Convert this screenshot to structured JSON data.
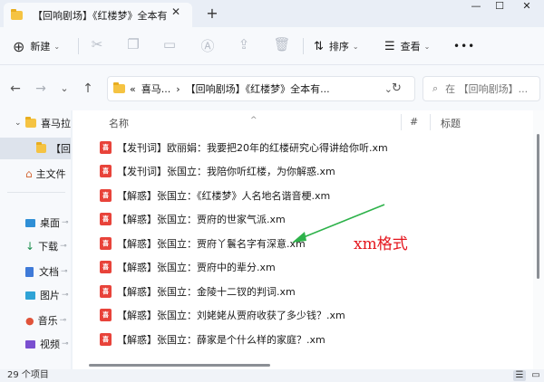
{
  "window": {
    "tab_title": "【回响剧场】《红楼梦》全本有",
    "tab_close": "✕",
    "new_tab": "+",
    "minimize": "—",
    "maximize": "☐",
    "close": "✕"
  },
  "toolbar": {
    "new_label": "新建",
    "sort_label": "排序",
    "view_label": "查看",
    "more_label": "•••"
  },
  "nav": {
    "back": "←",
    "forward": "→",
    "dropdown": "⌄",
    "up": "↑",
    "refresh": "↻"
  },
  "address": {
    "prefix": "«",
    "crumb1": "喜马...",
    "sep": "›",
    "crumb2": "【回响剧场】《红楼梦》全本有...",
    "dropdown": "⌄",
    "search_placeholder": "在 【回响剧场】..."
  },
  "sidebar": {
    "items": [
      {
        "label": "喜马拉",
        "expander": "⌄"
      },
      {
        "label": "【回"
      },
      {
        "label": "主文件"
      },
      {
        "label": "桌面"
      },
      {
        "label": "下载"
      },
      {
        "label": "文档"
      },
      {
        "label": "图片"
      },
      {
        "label": "音乐"
      },
      {
        "label": "视频"
      }
    ],
    "pin": "📌"
  },
  "columns": {
    "name": "名称",
    "number": "#",
    "title": "标题",
    "sort_indicator": "^"
  },
  "files": [
    {
      "name": "【发刊词】欧丽娟：我要把20年的红楼研究心得讲给你听.xm"
    },
    {
      "name": "【发刊词】张国立：我陪你听红楼，为你解惑.xm"
    },
    {
      "name": "【解惑】张国立：《红楼梦》人名地名谐音梗.xm"
    },
    {
      "name": "【解惑】张国立：贾府的世家气派.xm"
    },
    {
      "name": "【解惑】张国立：贾府丫鬟名字有深意.xm"
    },
    {
      "name": "【解惑】张国立：贾府中的辈分.xm"
    },
    {
      "name": "【解惑】张国立：金陵十二钗的判词.xm"
    },
    {
      "name": "【解惑】张国立：刘姥姥从贾府收获了多少钱？.xm"
    },
    {
      "name": "【解惑】张国立：薛家是个什么样的家庭？.xm"
    }
  ],
  "file_icon_text": "喜",
  "status": {
    "count": "29 个项目"
  },
  "annotation": {
    "text": "xm格式",
    "color": "#e4151d",
    "arrow_color": "#2db24a"
  },
  "colors": {
    "folder": "#f5c342",
    "file_icon": "#e8433a",
    "selected": "#dde3ec"
  }
}
